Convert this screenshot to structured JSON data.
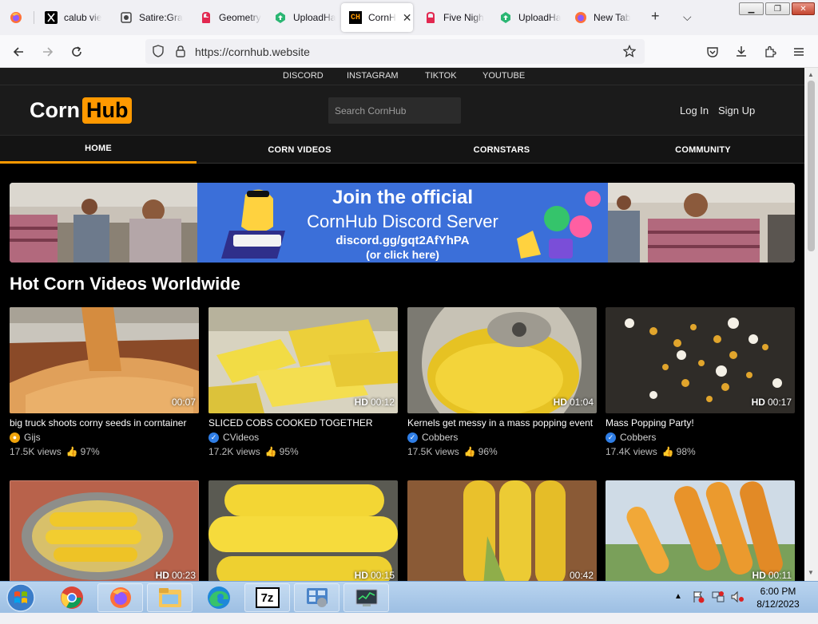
{
  "browser": {
    "tabs": [
      {
        "label": "calub vie",
        "icon": "x-logo-icon",
        "active": false
      },
      {
        "label": "Satire:Gra",
        "icon": "site-icon",
        "active": false
      },
      {
        "label": "Geometry",
        "icon": "recording-icon",
        "active": false
      },
      {
        "label": "UploadHa",
        "icon": "upload-icon",
        "active": false
      },
      {
        "label": "CornH",
        "icon": "cornhub-icon",
        "active": true
      },
      {
        "label": "Five Nigh",
        "icon": "recording-icon",
        "active": false
      },
      {
        "label": "UploadHa",
        "icon": "upload-icon",
        "active": false
      },
      {
        "label": "New Tab",
        "icon": "firefox-icon",
        "active": false
      }
    ],
    "active_tab_favicon_text": "CH",
    "url": "https://cornhub.website"
  },
  "site": {
    "social_links": [
      "DISCORD",
      "INSTAGRAM",
      "TIKTOK",
      "YOUTUBE"
    ],
    "logo_part1": "Corn",
    "logo_part2": "Hub",
    "search_placeholder": "Search CornHub",
    "login": "Log In",
    "signup": "Sign Up",
    "nav": [
      {
        "label": "HOME",
        "active": true
      },
      {
        "label": "CORN VIDEOS",
        "active": false
      },
      {
        "label": "CORNSTARS",
        "active": false
      },
      {
        "label": "COMMUNITY",
        "active": false
      }
    ],
    "banner": {
      "line1": "Join the official",
      "line2": "CornHub Discord Server",
      "line3": "discord.gg/gqt2AfYhPA",
      "line4": "(or click here)"
    },
    "section_title": "Hot Corn Videos Worldwide",
    "accent_color": "#ff9900",
    "videos": [
      {
        "title": "big truck shoots corny seeds in corntainer",
        "user": "Gijs",
        "badge": "orange",
        "views": "17.5K views",
        "rating": "97%",
        "hd": "",
        "duration": "00:07"
      },
      {
        "title": "SLICED COBS COOKED TOGETHER",
        "user": "CVideos",
        "badge": "blue",
        "views": "17.2K views",
        "rating": "95%",
        "hd": "HD",
        "duration": "00:12"
      },
      {
        "title": "Kernels get messy in a mass popping event",
        "user": "Cobbers",
        "badge": "blue",
        "views": "17.5K views",
        "rating": "96%",
        "hd": "HD",
        "duration": "01:04"
      },
      {
        "title": "Mass Popping Party!",
        "user": "Cobbers",
        "badge": "blue",
        "views": "17.4K views",
        "rating": "98%",
        "hd": "HD",
        "duration": "00:17"
      },
      {
        "title": "",
        "user": "",
        "badge": "",
        "views": "",
        "rating": "",
        "hd": "HD",
        "duration": "00:23"
      },
      {
        "title": "",
        "user": "",
        "badge": "",
        "views": "",
        "rating": "",
        "hd": "HD",
        "duration": "00:15"
      },
      {
        "title": "",
        "user": "",
        "badge": "",
        "views": "",
        "rating": "",
        "hd": "",
        "duration": "00:42"
      },
      {
        "title": "",
        "user": "",
        "badge": "",
        "views": "",
        "rating": "",
        "hd": "HD",
        "duration": "00:11"
      }
    ]
  },
  "taskbar": {
    "apps": [
      "chrome-icon",
      "firefox-icon",
      "file-explorer-icon",
      "edge-icon",
      "7zip-icon",
      "control-panel-icon",
      "task-manager-icon"
    ],
    "app_7z_label": "7z",
    "time": "6:00 PM",
    "date": "8/12/2023"
  }
}
